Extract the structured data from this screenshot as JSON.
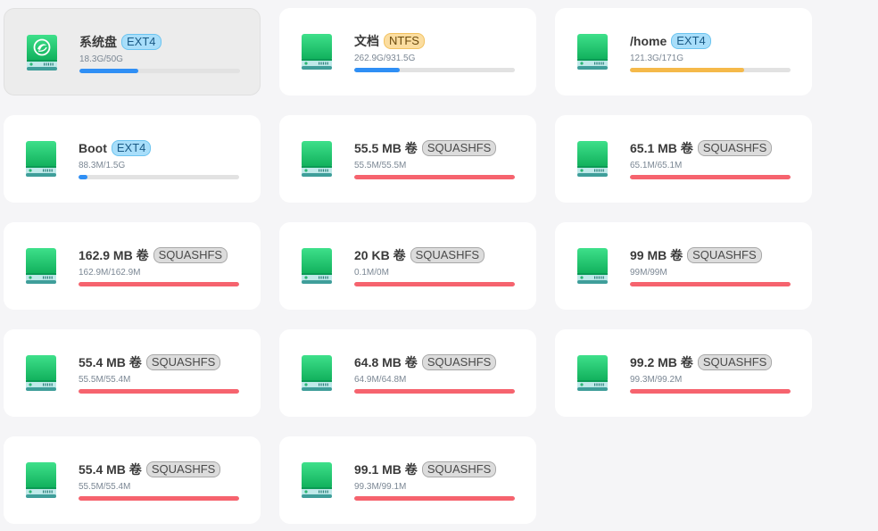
{
  "colors": {
    "blue": "#2f8ff5",
    "orange": "#f5b94a",
    "red": "#f6636e"
  },
  "disks": [
    {
      "name": "系统盘",
      "fs": "EXT4",
      "usage": "18.3G/50G",
      "fraction": 0.366,
      "bar": "blue",
      "icon": "system-disk-icon",
      "selected": true
    },
    {
      "name": "文档",
      "fs": "NTFS",
      "usage": "262.9G/931.5G",
      "fraction": 0.282,
      "bar": "blue",
      "icon": "drive-icon"
    },
    {
      "name": "/home",
      "fs": "EXT4",
      "usage": "121.3G/171G",
      "fraction": 0.709,
      "bar": "orange",
      "icon": "drive-icon"
    },
    {
      "name": "Boot",
      "fs": "EXT4",
      "usage": "88.3M/1.5G",
      "fraction": 0.057,
      "bar": "blue",
      "icon": "drive-icon"
    },
    {
      "name": "55.5 MB 卷",
      "fs": "SQUASHFS",
      "usage": "55.5M/55.5M",
      "fraction": 1,
      "bar": "red",
      "icon": "drive-icon"
    },
    {
      "name": "65.1 MB 卷",
      "fs": "SQUASHFS",
      "usage": "65.1M/65.1M",
      "fraction": 1,
      "bar": "red",
      "icon": "drive-icon"
    },
    {
      "name": "162.9 MB 卷",
      "fs": "SQUASHFS",
      "usage": "162.9M/162.9M",
      "fraction": 1,
      "bar": "red",
      "icon": "drive-icon"
    },
    {
      "name": "20 KB 卷",
      "fs": "SQUASHFS",
      "usage": "0.1M/0M",
      "fraction": 1,
      "bar": "red",
      "icon": "drive-icon"
    },
    {
      "name": "99 MB 卷",
      "fs": "SQUASHFS",
      "usage": "99M/99M",
      "fraction": 1,
      "bar": "red",
      "icon": "drive-icon"
    },
    {
      "name": "55.4 MB 卷",
      "fs": "SQUASHFS",
      "usage": "55.5M/55.4M",
      "fraction": 1,
      "bar": "red",
      "icon": "drive-icon"
    },
    {
      "name": "64.8 MB 卷",
      "fs": "SQUASHFS",
      "usage": "64.9M/64.8M",
      "fraction": 1,
      "bar": "red",
      "icon": "drive-icon"
    },
    {
      "name": "99.2 MB 卷",
      "fs": "SQUASHFS",
      "usage": "99.3M/99.2M",
      "fraction": 1,
      "bar": "red",
      "icon": "drive-icon"
    },
    {
      "name": "55.4 MB 卷",
      "fs": "SQUASHFS",
      "usage": "55.5M/55.4M",
      "fraction": 1,
      "bar": "red",
      "icon": "drive-icon"
    },
    {
      "name": "99.1 MB 卷",
      "fs": "SQUASHFS",
      "usage": "99.3M/99.1M",
      "fraction": 1,
      "bar": "red",
      "icon": "drive-icon"
    }
  ]
}
